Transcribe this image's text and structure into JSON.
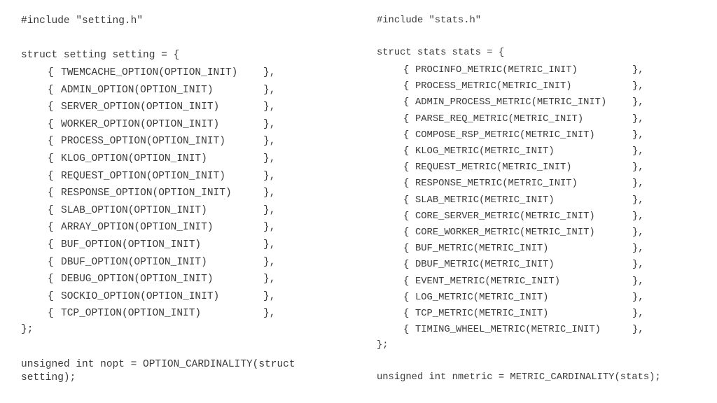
{
  "left": {
    "include": "#include \"setting.h\"",
    "struct_open": "struct setting setting = {",
    "entries": [
      "TWEMCACHE_OPTION(OPTION_INIT)",
      "ADMIN_OPTION(OPTION_INIT)",
      "SERVER_OPTION(OPTION_INIT)",
      "WORKER_OPTION(OPTION_INIT)",
      "PROCESS_OPTION(OPTION_INIT)",
      "KLOG_OPTION(OPTION_INIT)",
      "REQUEST_OPTION(OPTION_INIT)",
      "RESPONSE_OPTION(OPTION_INIT)",
      "SLAB_OPTION(OPTION_INIT)",
      "ARRAY_OPTION(OPTION_INIT)",
      "BUF_OPTION(OPTION_INIT)",
      "DBUF_OPTION(OPTION_INIT)",
      "DEBUG_OPTION(OPTION_INIT)",
      "SOCKIO_OPTION(OPTION_INIT)",
      "TCP_OPTION(OPTION_INIT)"
    ],
    "entry_open": "{",
    "entry_close": "},",
    "struct_close": "};",
    "tail_line1": "unsigned int nopt = OPTION_CARDINALITY(struct",
    "tail_line2": "setting);"
  },
  "right": {
    "include": "#include \"stats.h\"",
    "struct_open": "struct stats stats = {",
    "entries": [
      "PROCINFO_METRIC(METRIC_INIT)",
      "PROCESS_METRIC(METRIC_INIT)",
      "ADMIN_PROCESS_METRIC(METRIC_INIT)",
      "PARSE_REQ_METRIC(METRIC_INIT)",
      "COMPOSE_RSP_METRIC(METRIC_INIT)",
      "KLOG_METRIC(METRIC_INIT)",
      "REQUEST_METRIC(METRIC_INIT)",
      "RESPONSE_METRIC(METRIC_INIT)",
      "SLAB_METRIC(METRIC_INIT)",
      "CORE_SERVER_METRIC(METRIC_INIT)",
      "CORE_WORKER_METRIC(METRIC_INIT)",
      "BUF_METRIC(METRIC_INIT)",
      "DBUF_METRIC(METRIC_INIT)",
      "EVENT_METRIC(METRIC_INIT)",
      "LOG_METRIC(METRIC_INIT)",
      "TCP_METRIC(METRIC_INIT)",
      "TIMING_WHEEL_METRIC(METRIC_INIT)"
    ],
    "entry_open": "{",
    "entry_close": "},",
    "struct_close": "};",
    "tail_line1": "unsigned int nmetric = METRIC_CARDINALITY(stats);"
  }
}
